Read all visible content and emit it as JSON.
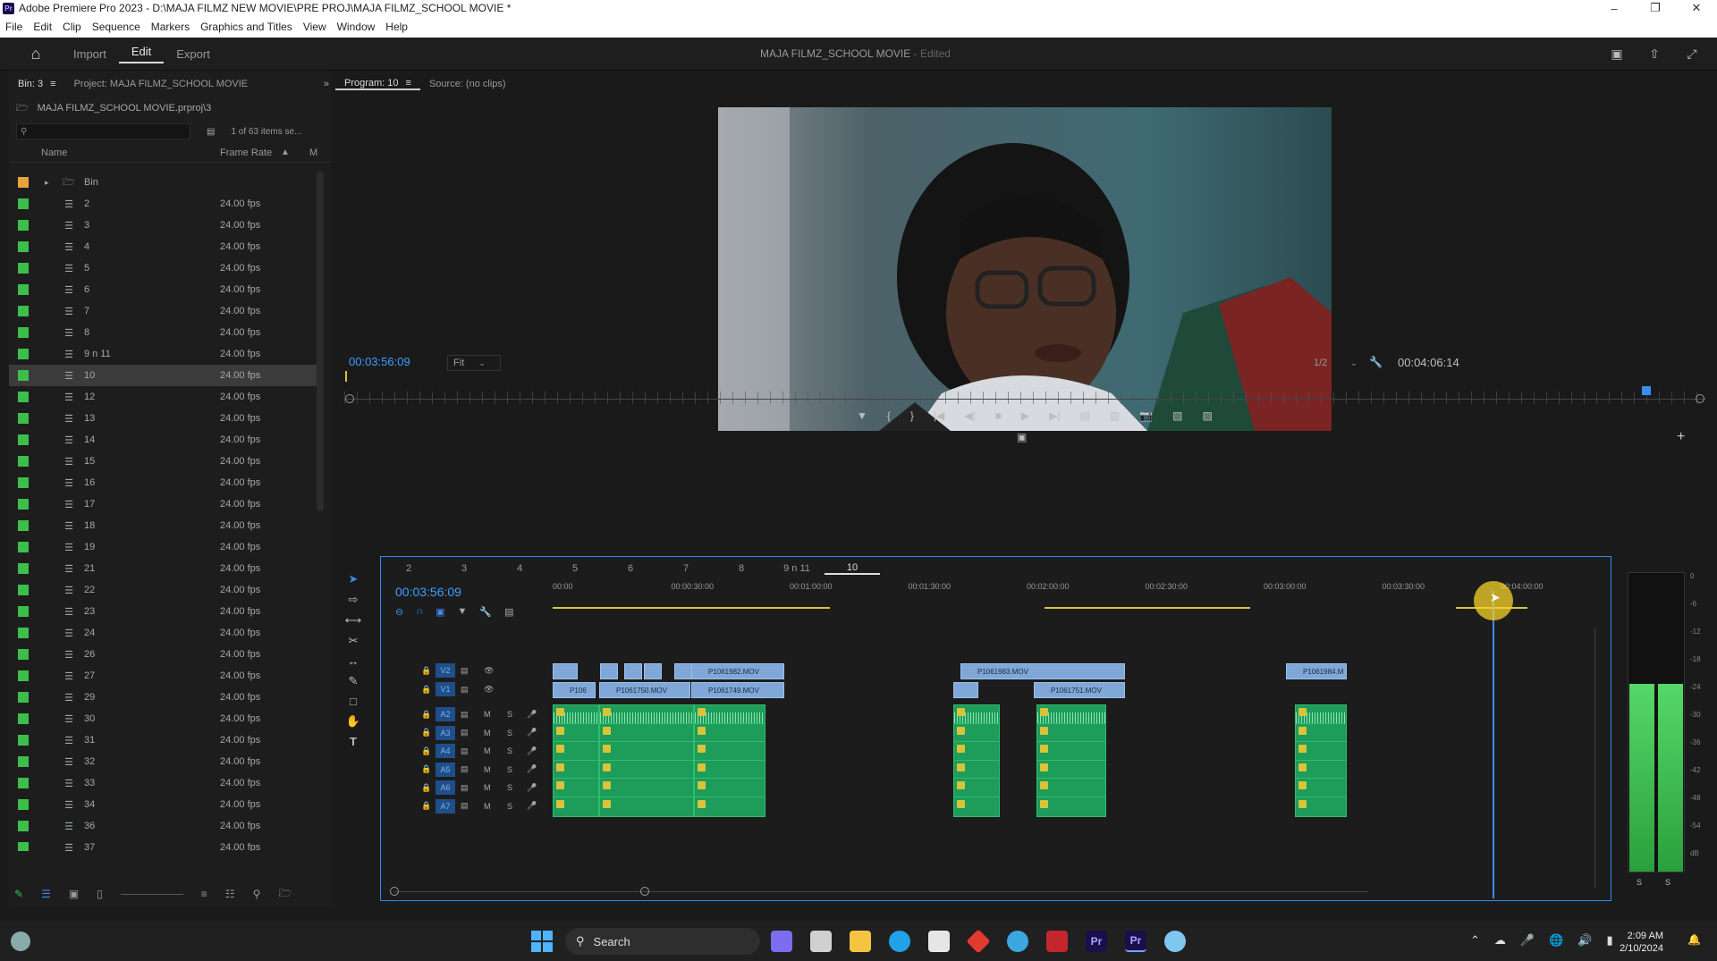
{
  "window": {
    "title": "Adobe Premiere Pro 2023 - D:\\MAJA FILMZ NEW MOVIE\\PRE PROJ\\MAJA FILMZ_SCHOOL MOVIE *",
    "app_icon": "Pr"
  },
  "menu": [
    "File",
    "Edit",
    "Clip",
    "Sequence",
    "Markers",
    "Graphics and Titles",
    "View",
    "Window",
    "Help"
  ],
  "header": {
    "tabs": [
      "Import",
      "Edit",
      "Export"
    ],
    "active_tab": "Edit",
    "project_title": "MAJA FILMZ_SCHOOL MOVIE",
    "edited": "- Edited"
  },
  "project_panel": {
    "bin_tab": "Bin: 3",
    "project_tab": "Project: MAJA FILMZ_SCHOOL MOVIE",
    "path": "MAJA FILMZ_SCHOOL MOVIE.prproj\\3",
    "items_count": "1 of 63 items se...",
    "columns": {
      "name": "Name",
      "frame_rate": "Frame Rate",
      "m": "M"
    },
    "items": [
      {
        "name": "Bin",
        "fps": "",
        "color": "#e6a43a",
        "type": "bin"
      },
      {
        "name": "2",
        "fps": "24.00 fps",
        "color": "#3bbf4a"
      },
      {
        "name": "3",
        "fps": "24.00 fps",
        "color": "#3bbf4a"
      },
      {
        "name": "4",
        "fps": "24.00 fps",
        "color": "#3bbf4a"
      },
      {
        "name": "5",
        "fps": "24.00 fps",
        "color": "#3bbf4a"
      },
      {
        "name": "6",
        "fps": "24.00 fps",
        "color": "#3bbf4a"
      },
      {
        "name": "7",
        "fps": "24.00 fps",
        "color": "#3bbf4a"
      },
      {
        "name": "8",
        "fps": "24.00 fps",
        "color": "#3bbf4a"
      },
      {
        "name": "9 n 11",
        "fps": "24.00 fps",
        "color": "#3bbf4a"
      },
      {
        "name": "10",
        "fps": "24.00 fps",
        "color": "#3bbf4a",
        "selected": true
      },
      {
        "name": "12",
        "fps": "24.00 fps",
        "color": "#3bbf4a"
      },
      {
        "name": "13",
        "fps": "24.00 fps",
        "color": "#3bbf4a"
      },
      {
        "name": "14",
        "fps": "24.00 fps",
        "color": "#3bbf4a"
      },
      {
        "name": "15",
        "fps": "24.00 fps",
        "color": "#3bbf4a"
      },
      {
        "name": "16",
        "fps": "24.00 fps",
        "color": "#3bbf4a"
      },
      {
        "name": "17",
        "fps": "24.00 fps",
        "color": "#3bbf4a"
      },
      {
        "name": "18",
        "fps": "24.00 fps",
        "color": "#3bbf4a"
      },
      {
        "name": "19",
        "fps": "24.00 fps",
        "color": "#3bbf4a"
      },
      {
        "name": "21",
        "fps": "24.00 fps",
        "color": "#3bbf4a"
      },
      {
        "name": "22",
        "fps": "24.00 fps",
        "color": "#3bbf4a"
      },
      {
        "name": "23",
        "fps": "24.00 fps",
        "color": "#3bbf4a"
      },
      {
        "name": "24",
        "fps": "24.00 fps",
        "color": "#3bbf4a"
      },
      {
        "name": "26",
        "fps": "24.00 fps",
        "color": "#3bbf4a"
      },
      {
        "name": "27",
        "fps": "24.00 fps",
        "color": "#3bbf4a"
      },
      {
        "name": "29",
        "fps": "24.00 fps",
        "color": "#3bbf4a"
      },
      {
        "name": "30",
        "fps": "24.00 fps",
        "color": "#3bbf4a"
      },
      {
        "name": "31",
        "fps": "24.00 fps",
        "color": "#3bbf4a"
      },
      {
        "name": "32",
        "fps": "24.00 fps",
        "color": "#3bbf4a"
      },
      {
        "name": "33",
        "fps": "24.00 fps",
        "color": "#3bbf4a"
      },
      {
        "name": "34",
        "fps": "24.00 fps",
        "color": "#3bbf4a"
      },
      {
        "name": "36",
        "fps": "24.00 fps",
        "color": "#3bbf4a"
      },
      {
        "name": "37",
        "fps": "24.00 fps",
        "color": "#3bbf4a"
      }
    ]
  },
  "program_monitor": {
    "tab": "Program: 10",
    "source_tab": "Source: (no clips)",
    "timecode": "00:03:56:09",
    "fit": "Fit",
    "resolution": "1/2",
    "duration": "00:04:06:14"
  },
  "timeline": {
    "sequence_tabs": [
      "2",
      "3",
      "4",
      "5",
      "6",
      "7",
      "8",
      "9 n 11",
      "10"
    ],
    "active_sequence": "10",
    "timecode": "00:03:56:09",
    "ruler": [
      "00:00",
      "00:00:30:00",
      "00:01:00:00",
      "00:01:30:00",
      "00:02:00:00",
      "00:02:30:00",
      "00:03:00:00",
      "00:03:30:00",
      "00:04:00:00"
    ],
    "video_tracks": [
      "V2",
      "V1"
    ],
    "audio_tracks": [
      "A2",
      "A3",
      "A4",
      "A5",
      "A6",
      "A7"
    ],
    "v2_clips": [
      "P1061982.MOV",
      "P1061983.MOV",
      "P1061984.M"
    ],
    "v1_clips": [
      "P106",
      "P1061750.MOV",
      "P1061749.MOV",
      "P1061751.MOV"
    ]
  },
  "meter": {
    "scale": [
      "0",
      "-6",
      "-12",
      "-18",
      "-24",
      "-30",
      "-36",
      "-42",
      "-48",
      "-54",
      "dB"
    ],
    "solo": [
      "S",
      "S"
    ]
  },
  "taskbar": {
    "search": "Search",
    "time": "2:09 AM",
    "date": "2/10/2024"
  },
  "colors": {
    "accent": "#2c8cf0",
    "timecode": "#3ca0ff",
    "video_clip": "#7fa7d8",
    "audio_clip": "#1e9c5a",
    "playhead_highlight": "#f5d328"
  }
}
